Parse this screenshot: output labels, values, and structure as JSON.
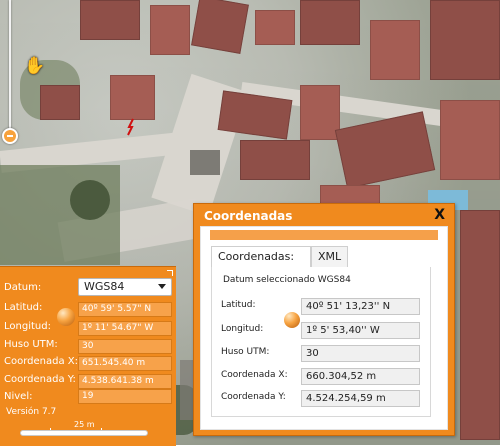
{
  "left_panel": {
    "datum_label": "Datum:",
    "datum_value": "WGS84",
    "fields": [
      {
        "label": "Latitud:",
        "value": "40º 59' 5.57\" N"
      },
      {
        "label": "Longitud:",
        "value": "1º 11' 54.67\" W"
      },
      {
        "label": "Huso UTM:",
        "value": "30"
      },
      {
        "label": "Coordenada X:",
        "value": "651.545.40 m"
      },
      {
        "label": "Coordenada Y:",
        "value": "4.538.641.38 m"
      },
      {
        "label": "Nivel:",
        "value": "19"
      }
    ],
    "version": "Versión 7.7",
    "scale_label": "25 m"
  },
  "dialog": {
    "title": "Coordenadas",
    "close": "X",
    "tabs": [
      "Coordenadas:",
      "XML"
    ],
    "datum_text": "Datum seleccionado WGS84",
    "fields": [
      {
        "label": "Latitud:",
        "value": "40º 51' 13,23'' N"
      },
      {
        "label": "Longitud:",
        "value": "1º 5' 53,40'' W"
      },
      {
        "label": "Huso UTM:",
        "value": "30"
      },
      {
        "label": "Coordenada X:",
        "value": "660.304,52 m"
      },
      {
        "label": "Coordenada Y:",
        "value": "4.524.254,59 m"
      }
    ]
  },
  "icons": {
    "pan_cursor": "hand-icon",
    "map_marker": "marker-icon",
    "zoom_knob": "zoom-slider-icon"
  },
  "colors": {
    "accent": "#f08a1e",
    "accent_light": "#f7a24a",
    "marker_red": "#d01010"
  }
}
